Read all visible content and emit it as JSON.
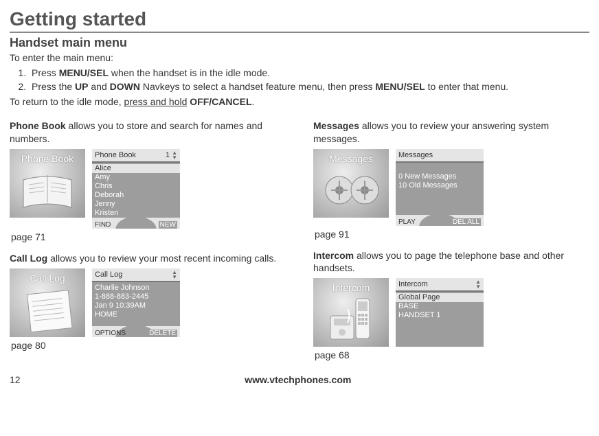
{
  "page_title": "Getting started",
  "subtitle": "Handset main menu",
  "intro": {
    "line1": "To enter the main menu:",
    "step1_pre": "Press ",
    "step1_bold": "MENU/SEL",
    "step1_post": " when the handset is in the idle mode.",
    "step2_pre": "Press the ",
    "step2_b1": "UP",
    "step2_mid1": " and ",
    "step2_b2": "DOWN",
    "step2_mid2": " Navkeys to select a handset feature menu, then press ",
    "step2_b3": "MENU/SEL",
    "step2_post": " to enter that menu.",
    "return_pre": "To return to the idle mode, ",
    "return_und": "press and hold",
    "return_space": " ",
    "return_bold": "OFF/CANCEL",
    "return_post": "."
  },
  "phonebook": {
    "desc_bold": "Phone Book",
    "desc_rest": " allows you to store and search for names and numbers.",
    "thumb_title": "Phone Book",
    "screen_title": "Phone Book",
    "screen_badge": "1",
    "entries": [
      "Alice",
      "Amy",
      "Chris",
      "Deborah",
      "Jenny",
      "Kristen"
    ],
    "soft_left": "FIND",
    "soft_right": "NEW",
    "page_ref": "page 71"
  },
  "calllog": {
    "desc_bold": "Call Log",
    "desc_rest": " allows you to review your most recent incoming calls.",
    "thumb_title": "Call Log",
    "screen_title": "Call Log",
    "lines": [
      "Charlie Johnson",
      "1-888-883-2445",
      " Jan 9  10:39AM",
      "HOME"
    ],
    "soft_left": "OPTIONS",
    "soft_right": "DELETE",
    "page_ref": "page 80"
  },
  "messages": {
    "desc_bold": "Messages",
    "desc_rest": " allows you to review your answering system messages.",
    "thumb_title": "Messages",
    "screen_title": "Messages",
    "lines": [
      "0 New Messages",
      "10 Old Messages"
    ],
    "soft_left": "PLAY",
    "soft_right": "DEL ALL",
    "page_ref": "page 91"
  },
  "intercom": {
    "desc_bold": "Intercom",
    "desc_rest": " allows you to page the telephone base and other handsets.",
    "thumb_title": "Intercom",
    "screen_title": "Intercom",
    "highlight": "Global Page",
    "lines": [
      "BASE",
      "HANDSET 1"
    ],
    "page_ref": "page 68"
  },
  "footer": {
    "page_num": "12",
    "url": "www.vtechphones.com"
  }
}
